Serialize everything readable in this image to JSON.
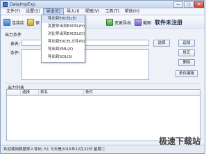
{
  "window": {
    "title": "DataImpExp",
    "controls": {
      "minimize": "—",
      "maximize": "□",
      "close": "✕"
    }
  },
  "menubar": {
    "items": [
      {
        "label": "文件(F)"
      },
      {
        "label": "设置(S)"
      },
      {
        "label": "导出(E)",
        "active": true
      },
      {
        "label": "导入(I)"
      },
      {
        "label": "视图(V)"
      },
      {
        "label": "工具(T)"
      },
      {
        "label": "帮助(H)"
      }
    ]
  },
  "export_menu": {
    "items": [
      "导出到EXCEL(E)",
      "变更导出到EXCEL(H)",
      "对比导出到EXCEL(D)",
      "导出到EXCEL文件(N)",
      "导出到XML(X)",
      "导出到SQL(S)"
    ]
  },
  "toolbar": {
    "connect_label": "连接库",
    "save_label": "保",
    "export_change_label": "变更导出",
    "screenshot_label": "截图",
    "register_label": "软件未注册"
  },
  "form": {
    "output_conditions_title": "出力条件",
    "table_label": "表名:",
    "condition_label": "条件:",
    "select_button": "选择",
    "add_button": "追加",
    "modify_button": "修正",
    "delete_button": "删除",
    "edit_condition_button": "条件编辑"
  },
  "output_list": {
    "title": "出力列表",
    "columns": [
      "选择",
      "表名",
      "条件"
    ]
  },
  "statusbar": {
    "text": "欢迎使用数据导入导出: 51 今天是2015年12月22日  星期二"
  },
  "watermark": {
    "text": "极速下载站"
  },
  "colors": {
    "menu_active": "#c3d7f3",
    "window_bg": "#eef2f8",
    "border": "#8aa0c0"
  }
}
